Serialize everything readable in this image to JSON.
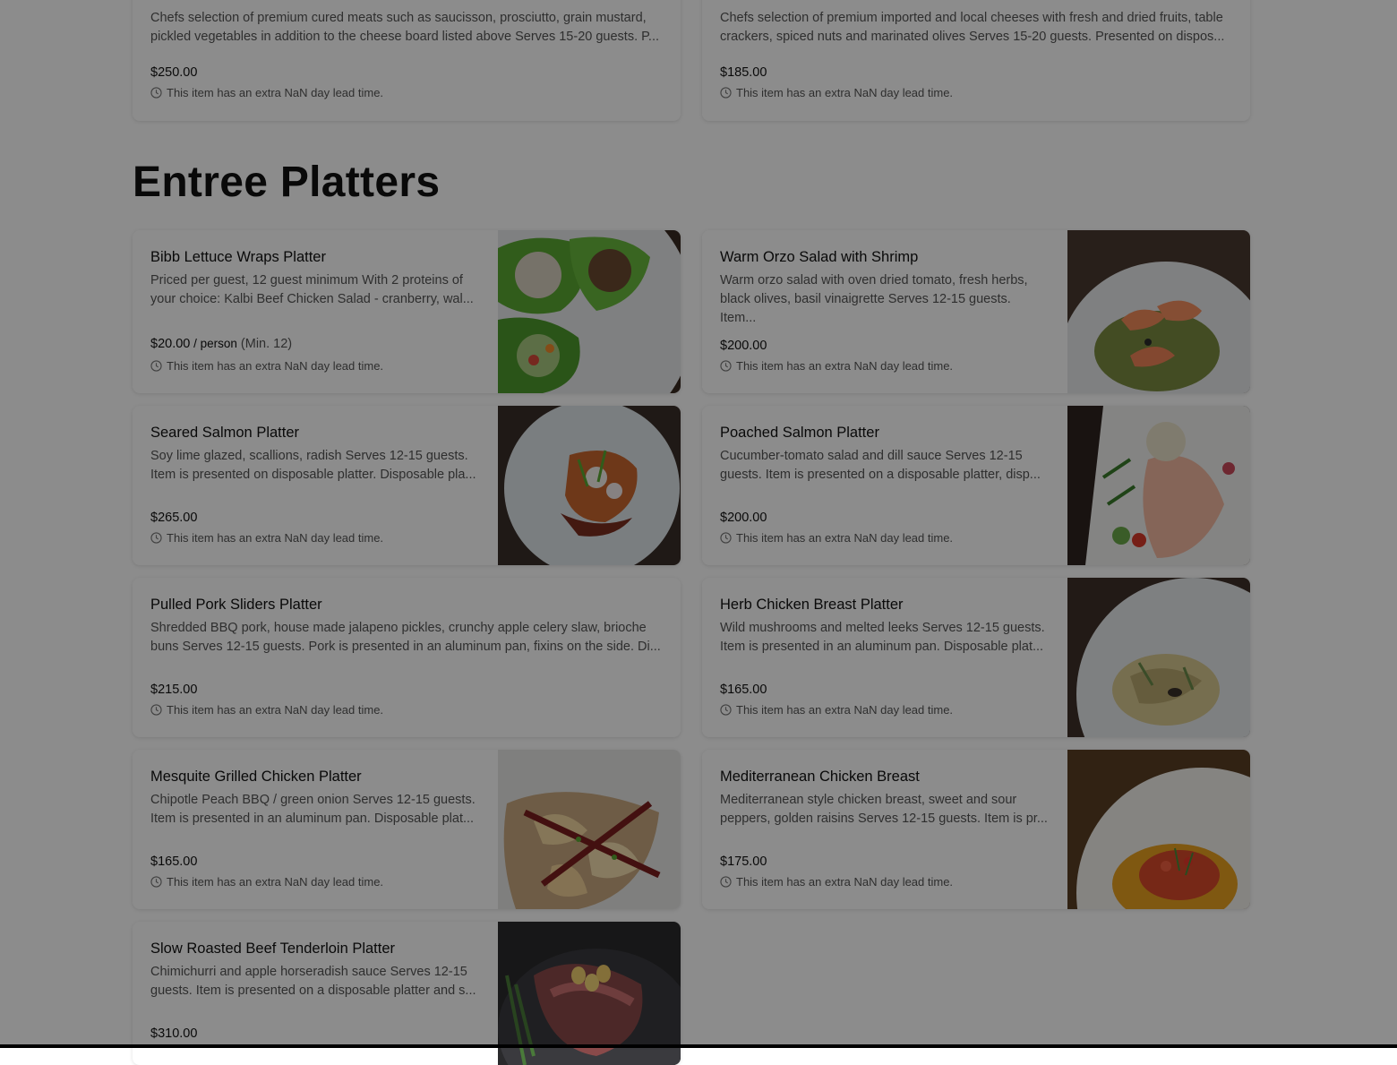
{
  "top_cards": [
    {
      "desc": "Chefs selection of premium cured meats such as saucisson, prosciutto, grain mustard, pickled vegetables in addition to the cheese board listed above Serves 15-20 guests. P...",
      "price": "$250.00",
      "lead": "This item has an extra NaN day lead time."
    },
    {
      "desc": "Chefs selection of premium imported and local cheeses with fresh and dried fruits, table crackers, spiced nuts and marinated olives Serves 15-20 guests. Presented on dispos...",
      "price": "$185.00",
      "lead": "This item has an extra NaN day lead time."
    }
  ],
  "section": {
    "title": "Entree Platters"
  },
  "items": [
    {
      "title": "Bibb Lettuce Wraps Platter",
      "desc": "Priced per guest, 12 guest minimum With 2 proteins of your choice: Kalbi Beef Chicken Salad - cranberry, wal...",
      "price": "$20.00",
      "unit": " / person",
      "min": " (Min. 12)",
      "lead": "This item has an extra NaN day lead time."
    },
    {
      "title": "Warm Orzo Salad with Shrimp",
      "desc": "Warm orzo salad with oven dried tomato, fresh herbs, black olives, basil vinaigrette Serves 12-15 guests. Item...",
      "price": "$200.00",
      "lead": "This item has an extra NaN day lead time."
    },
    {
      "title": "Seared Salmon Platter",
      "desc": "Soy lime glazed, scallions, radish Serves 12-15 guests. Item is presented on disposable platter. Disposable pla...",
      "price": "$265.00",
      "lead": "This item has an extra NaN day lead time."
    },
    {
      "title": "Poached Salmon Platter",
      "desc": "Cucumber-tomato salad and dill sauce Serves 12-15 guests. Item is presented on a disposable platter, disp...",
      "price": "$200.00",
      "lead": "This item has an extra NaN day lead time."
    },
    {
      "title": "Pulled Pork Sliders Platter",
      "desc": "Shredded BBQ pork, house made jalapeno pickles, crunchy apple celery slaw, brioche buns Serves 12-15 guests. Pork is presented in an aluminum pan, fixins on the side. Di...",
      "price": "$215.00",
      "lead": "This item has an extra NaN day lead time."
    },
    {
      "title": "Herb Chicken Breast Platter",
      "desc": "Wild mushrooms and melted leeks Serves 12-15 guests. Item is presented in an aluminum pan. Disposable plat...",
      "price": "$165.00",
      "lead": "This item has an extra NaN day lead time."
    },
    {
      "title": "Mesquite Grilled Chicken Platter",
      "desc": "Chipotle Peach BBQ / green onion Serves 12-15 guests. Item is presented in an aluminum pan. Disposable plat...",
      "price": "$165.00",
      "lead": "This item has an extra NaN day lead time."
    },
    {
      "title": "Mediterranean Chicken Breast",
      "desc": "Mediterranean style chicken breast, sweet and sour peppers, golden raisins Serves 12-15 guests. Item is pr...",
      "price": "$175.00",
      "lead": "This item has an extra NaN day lead time."
    },
    {
      "title": "Slow Roasted Beef Tenderloin Platter",
      "desc": "Chimichurri and apple horseradish sauce Serves 12-15 guests. Item is presented on a disposable platter and s...",
      "price": "$310.00"
    }
  ],
  "icons": {
    "clock": "clock-icon"
  },
  "colors": {
    "overlay": "#000000",
    "lettuce": "#5aa832",
    "plate": "#e8eaec",
    "wood": "#4a3a30"
  }
}
